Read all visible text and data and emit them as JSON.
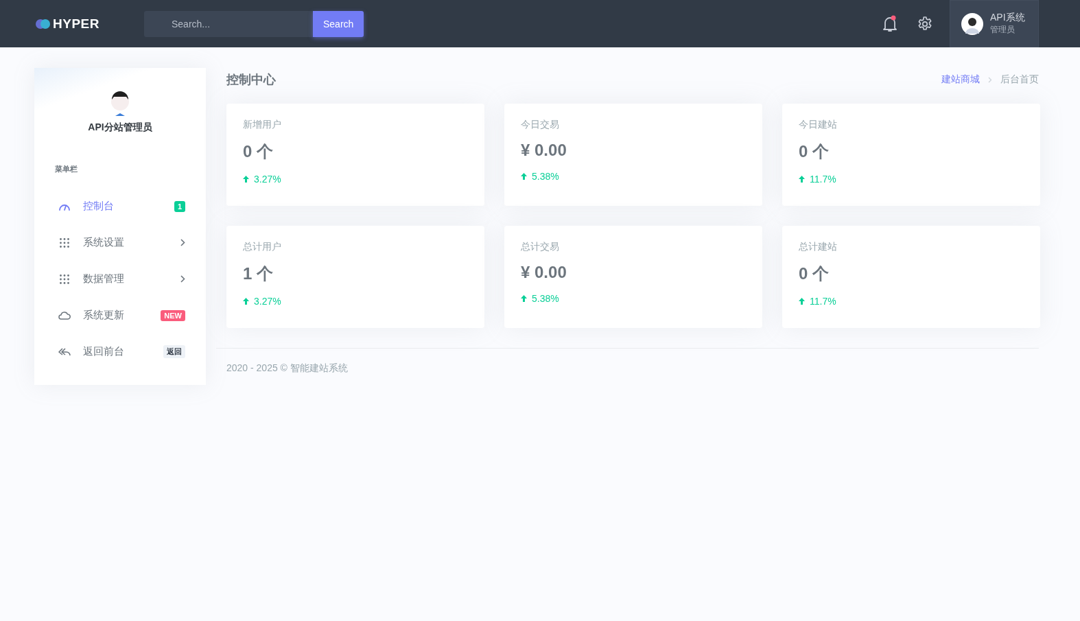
{
  "topbar": {
    "logo": "HYPER",
    "search": {
      "placeholder": "Search...",
      "button": "Search"
    },
    "notification": {
      "unread": true
    },
    "user": {
      "name": "API系统",
      "role": "管理员"
    }
  },
  "sidebar": {
    "profile_name": "API分站管理员",
    "section_title": "菜单栏",
    "items": [
      {
        "label": "控制台",
        "kind": "gauge",
        "selected": true,
        "badge": {
          "text": "1",
          "kind": "success"
        },
        "has_submenu": false
      },
      {
        "label": "系统设置",
        "kind": "grid",
        "selected": false,
        "has_submenu": true
      },
      {
        "label": "数据管理",
        "kind": "grid",
        "selected": false,
        "has_submenu": true
      },
      {
        "label": "系统更新",
        "kind": "cloud",
        "selected": false,
        "badge": {
          "text": "NEW",
          "kind": "danger"
        },
        "has_submenu": false
      },
      {
        "label": "返回前台",
        "kind": "reply",
        "selected": false,
        "badge": {
          "text": "返回",
          "kind": "light"
        },
        "has_submenu": false
      }
    ]
  },
  "page_title": "控制中心",
  "breadcrumb": [
    {
      "label": "建站商城",
      "selected": false
    },
    {
      "label": "后台首页",
      "selected": true
    }
  ],
  "stats": [
    {
      "label": "新增用户",
      "value": "0 个",
      "change": "3.27%"
    },
    {
      "label": "今日交易",
      "value": "¥ 0.00",
      "change": "5.38%"
    },
    {
      "label": "今日建站",
      "value": "0 个",
      "change": "11.7%"
    },
    {
      "label": "总计用户",
      "value": "1 个",
      "change": "3.27%"
    },
    {
      "label": "总计交易",
      "value": "¥ 0.00",
      "change": "5.38%"
    },
    {
      "label": "总计建站",
      "value": "0 个",
      "change": "11.7%"
    }
  ],
  "footer": "2020 - 2025 © 智能建站系统"
}
